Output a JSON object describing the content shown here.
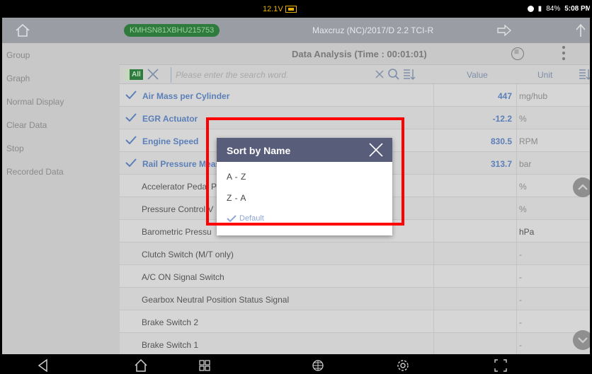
{
  "status_bar": {
    "voltage": "12.1V",
    "battery": "84%",
    "time": "5:08 PM"
  },
  "title_bar": {
    "vin": "KMHSN81XBHU215753",
    "vehicle": "Maxcruz (NC)/2017/D 2.2 TCI-R"
  },
  "sidebar": {
    "items": [
      {
        "label": "Group"
      },
      {
        "label": "Graph"
      },
      {
        "label": "Normal Display"
      },
      {
        "label": "Clear Data"
      },
      {
        "label": "Stop"
      },
      {
        "label": "Recorded Data"
      }
    ]
  },
  "header": {
    "title": "Data Analysis (Time : 00:01:01)"
  },
  "search": {
    "all_label": "All",
    "placeholder": "Please enter the search word."
  },
  "columns": {
    "value": "Value",
    "unit": "Unit"
  },
  "rows": [
    {
      "name": "Air Mass per Cylinder",
      "value": "447",
      "unit": "mg/hub",
      "selected": true
    },
    {
      "name": "EGR Actuator",
      "value": "-12.2",
      "unit": "%",
      "selected": true
    },
    {
      "name": "Engine Speed",
      "value": "830.5",
      "unit": "RPM",
      "selected": true
    },
    {
      "name": "Rail Pressure Meas",
      "value": "313.7",
      "unit": "bar",
      "selected": true
    },
    {
      "name": "Accelerator Pedal P",
      "value": "",
      "unit": "%",
      "selected": false
    },
    {
      "name": "Pressure Control V",
      "value": "",
      "unit": "%",
      "selected": false
    },
    {
      "name": "Barometric Pressu",
      "value": "",
      "unit": "hPa",
      "selected": false
    },
    {
      "name": "Clutch Switch (M/T only)",
      "value": "",
      "unit": "-",
      "selected": false
    },
    {
      "name": "A/C ON Signal Switch",
      "value": "",
      "unit": "-",
      "selected": false
    },
    {
      "name": "Gearbox Neutral Position Status Signal",
      "value": "",
      "unit": "-",
      "selected": false
    },
    {
      "name": "Brake Switch 2",
      "value": "",
      "unit": "-",
      "selected": false
    },
    {
      "name": "Brake Switch 1",
      "value": "",
      "unit": "-",
      "selected": false
    }
  ],
  "dialog": {
    "title": "Sort by Name",
    "options": [
      {
        "label": "A - Z"
      },
      {
        "label": "Z - A"
      }
    ],
    "default_label": "Default"
  },
  "colors": {
    "accent": "#5b7fb8",
    "dialog_header": "#585d7a",
    "highlight": "#ff0000",
    "vin_pill": "#2f7a3d"
  }
}
